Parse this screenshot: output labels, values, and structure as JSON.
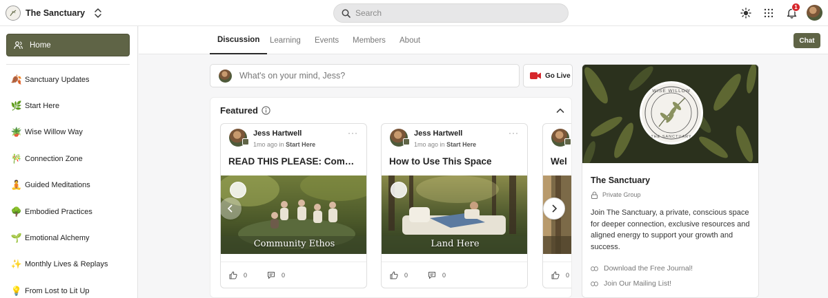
{
  "brand": {
    "name": "The Sanctuary"
  },
  "search": {
    "placeholder": "Search"
  },
  "notifications": {
    "count": "1"
  },
  "sidebar": {
    "home_label": "Home",
    "items": [
      {
        "label": "Sanctuary Updates",
        "icon": "fallen-leaf-icon"
      },
      {
        "label": "Start Here",
        "icon": "leaf-icon"
      },
      {
        "label": "Wise Willow Way",
        "icon": "potted-plant-icon"
      },
      {
        "label": "Connection Zone",
        "icon": "bamboo-icon"
      },
      {
        "label": "Guided Meditations",
        "icon": "meditation-icon"
      },
      {
        "label": "Embodied Practices",
        "icon": "tree-icon"
      },
      {
        "label": "Emotional Alchemy",
        "icon": "seedling-icon"
      },
      {
        "label": "Monthly Lives & Replays",
        "icon": "sparkles-icon"
      },
      {
        "label": "From Lost to Lit Up",
        "icon": "lightbulb-icon"
      }
    ]
  },
  "tabs": [
    "Discussion",
    "Learning",
    "Events",
    "Members",
    "About"
  ],
  "active_tab": "Discussion",
  "chat_label": "Chat",
  "composer": {
    "placeholder": "What's on your mind, Jess?",
    "go_live_label": "Go Live"
  },
  "featured": {
    "title": "Featured",
    "cards": [
      {
        "author": "Jess Hartwell",
        "time": "1mo ago",
        "in_label": "in",
        "space": "Start Here",
        "title": "READ THIS PLEASE: Community Ethos",
        "image_caption": "Community Ethos",
        "likes": "0",
        "comments": "0"
      },
      {
        "author": "Jess Hartwell",
        "time": "1mo ago",
        "in_label": "in",
        "space": "Start Here",
        "title": "How to Use This Space",
        "image_caption": "Land Here",
        "likes": "0",
        "comments": "0"
      },
      {
        "title": "Wel",
        "likes": "0"
      }
    ]
  },
  "group": {
    "name": "The Sanctuary",
    "type": "Private Group",
    "description": "Join The Sanctuary, a private, conscious space for deeper connection, exclusive resources and aligned energy to support your growth and success.",
    "links": [
      "Download the Free Journal!",
      "Join Our Mailing List!"
    ],
    "logo_text": "WISE WILLOW · THE SANCTUARY"
  },
  "colors": {
    "accent": "#5f6446",
    "badge": "#d6262b",
    "live": "#d6262b"
  }
}
